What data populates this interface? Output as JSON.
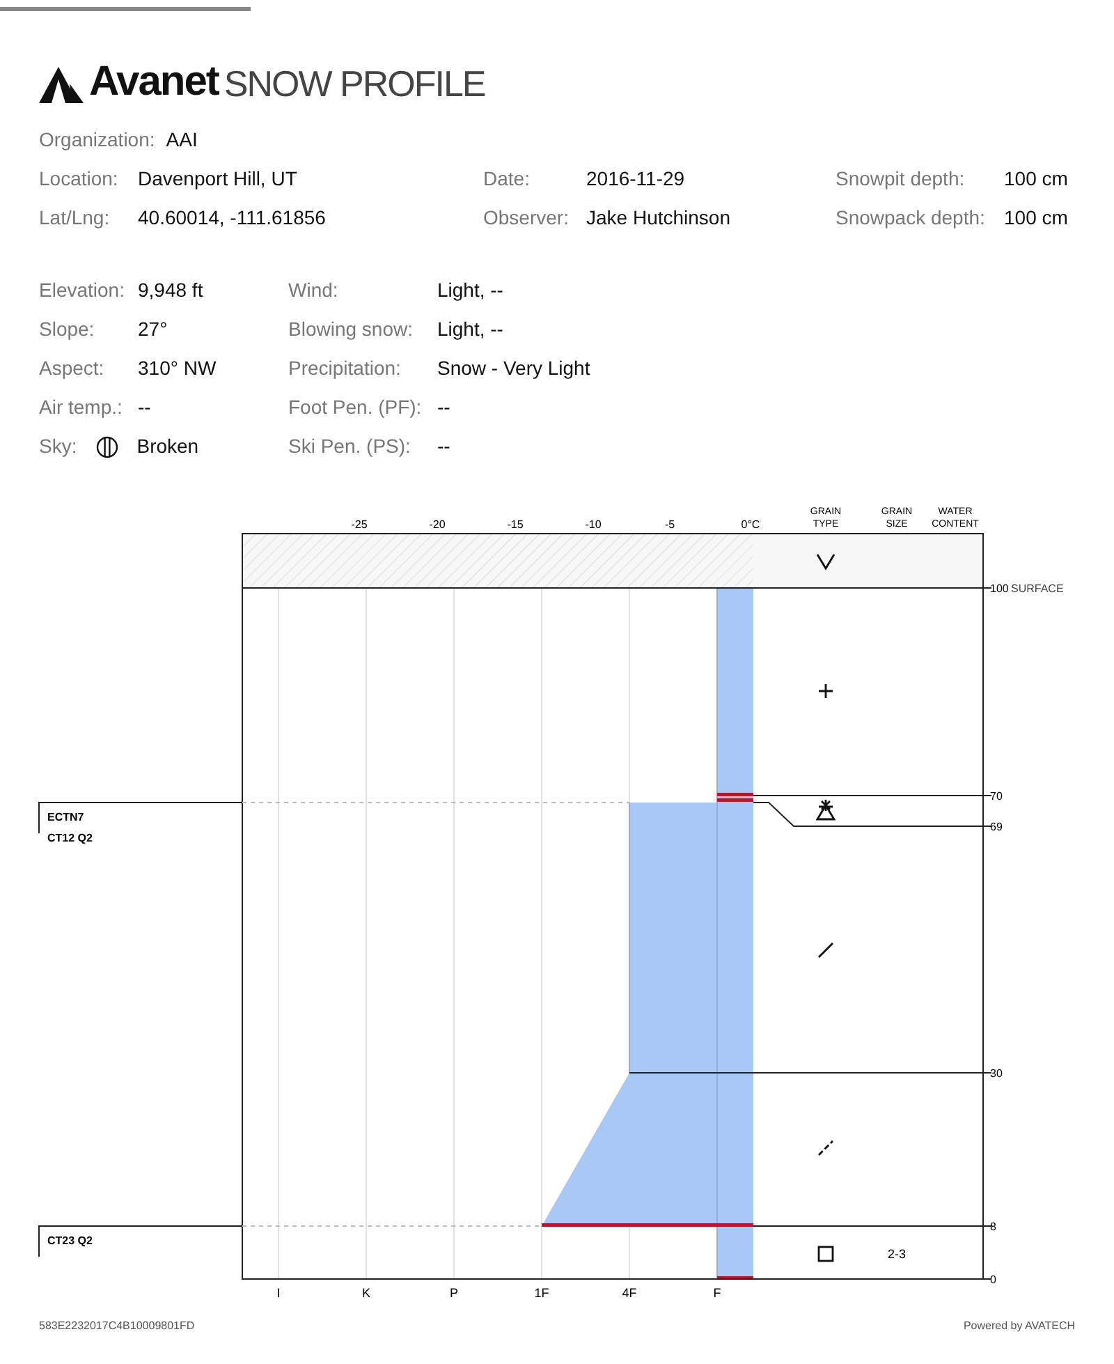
{
  "logo": {
    "brand": "Avanet",
    "title": "SNOW PROFILE"
  },
  "info_top": [
    [
      {
        "label": "Organization:",
        "value": "AAI"
      }
    ],
    [
      {
        "label": "Location:",
        "value": "Davenport Hill, UT"
      },
      {
        "label": "Date:",
        "value": "2016-11-29"
      },
      {
        "label": "Snowpit depth:",
        "value": "100 cm"
      }
    ],
    [
      {
        "label": "Lat/Lng:",
        "value": "40.60014, -111.61856"
      },
      {
        "label": "Observer:",
        "value": "Jake Hutchinson"
      },
      {
        "label": "Snowpack depth:",
        "value": "100 cm"
      }
    ]
  ],
  "info_conditions": [
    [
      {
        "label": "Elevation:",
        "value": "9,948 ft"
      },
      {
        "label": "Wind:",
        "value": "Light, --"
      }
    ],
    [
      {
        "label": "Slope:",
        "value": "27°"
      },
      {
        "label": "Blowing snow:",
        "value": "Light, --"
      }
    ],
    [
      {
        "label": "Aspect:",
        "value": "310° NW"
      },
      {
        "label": "Precipitation:",
        "value": "Snow - Very Light"
      }
    ],
    [
      {
        "label": "Air temp.:",
        "value": "--"
      },
      {
        "label": "Foot Pen. (PF):",
        "value": "--"
      }
    ],
    [
      {
        "label": "Sky:",
        "value": "Broken"
      },
      {
        "label": "Ski Pen. (PS):",
        "value": "--"
      }
    ]
  ],
  "chart": {
    "temperature_ticks": [
      "-25",
      "-20",
      "-15",
      "-10",
      "-5",
      "0°C"
    ],
    "column_headers": [
      {
        "lines": [
          "GRAIN",
          "TYPE"
        ]
      },
      {
        "lines": [
          "GRAIN",
          "SIZE"
        ]
      },
      {
        "lines": [
          "WATER",
          "CONTENT"
        ]
      }
    ],
    "hardness_ticks": [
      "I",
      "K",
      "P",
      "1F",
      "4F",
      "F"
    ],
    "height_labels": [
      {
        "value": "100",
        "note": "SURFACE"
      },
      {
        "value": "70"
      },
      {
        "value": "69"
      },
      {
        "value": "30"
      },
      {
        "value": "8"
      },
      {
        "value": "0"
      }
    ],
    "grain_rows": [
      {
        "kind": "caret"
      },
      {
        "kind": "plus"
      },
      {
        "kind": "hat-triangle"
      },
      {
        "kind": "slash"
      },
      {
        "kind": "dashed-slash"
      },
      {
        "kind": "square",
        "grain_size": "2-3"
      }
    ],
    "tests": [
      {
        "lines": [
          "ECTN7",
          "CT12 Q2"
        ]
      },
      {
        "lines": [
          "CT23 Q2"
        ]
      }
    ]
  },
  "footer": {
    "id": "583E2232017C4B10009801FD",
    "credit": "Powered by AVATECH"
  }
}
